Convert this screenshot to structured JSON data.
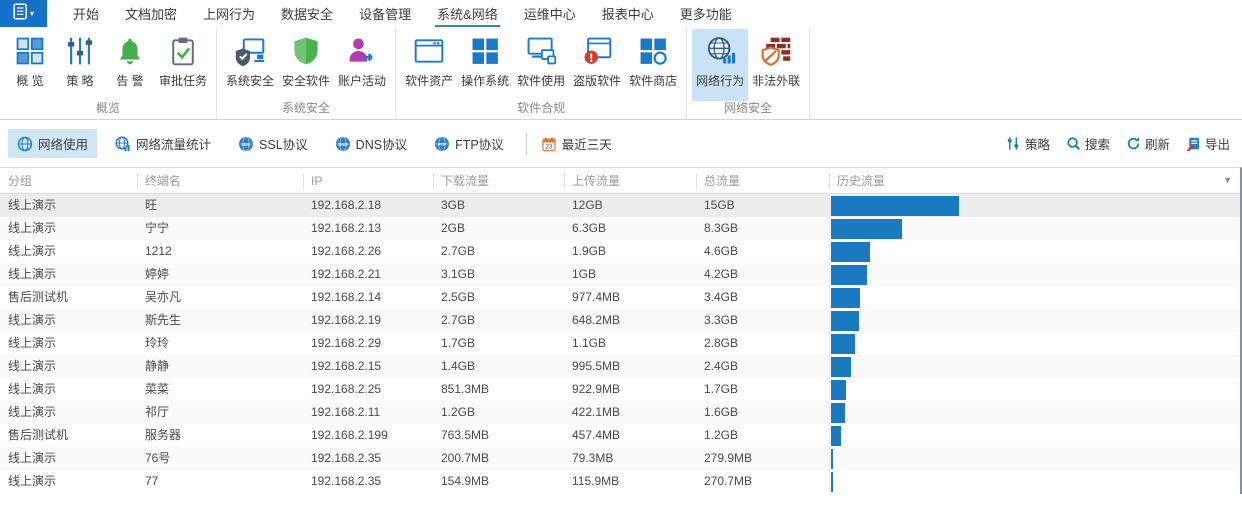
{
  "colors": {
    "app_button_blue": "#1470c8",
    "active_tab_underline": "#3488a8",
    "selected_item_bg": "#c9e2f5",
    "history_bar_color": "#1b79c0",
    "action_icon_teal": "#0e8596"
  },
  "menubar": {
    "tabs": [
      {
        "label": "开始",
        "active": false
      },
      {
        "label": "文档加密",
        "active": false
      },
      {
        "label": "上网行为",
        "active": false
      },
      {
        "label": "数据安全",
        "active": false
      },
      {
        "label": "设备管理",
        "active": false
      },
      {
        "label": "系统&网络",
        "active": true
      },
      {
        "label": "运维中心",
        "active": false
      },
      {
        "label": "报表中心",
        "active": false
      },
      {
        "label": "更多功能",
        "active": false
      }
    ]
  },
  "ribbon": {
    "groups": [
      {
        "label": "概览",
        "items": [
          {
            "label": "概 览",
            "icon": "overview-grid-icon",
            "active": false
          },
          {
            "label": "策 略",
            "icon": "policy-sliders-icon",
            "active": false
          },
          {
            "label": "告 警",
            "icon": "alert-bell-icon",
            "active": false
          },
          {
            "label": "审批任务",
            "icon": "approval-clipboard-icon",
            "active": false
          }
        ]
      },
      {
        "label": "系统安全",
        "items": [
          {
            "label": "系统安全",
            "icon": "system-security-icon",
            "active": false
          },
          {
            "label": "安全软件",
            "icon": "security-software-shield-icon",
            "active": false
          },
          {
            "label": "账户活动",
            "icon": "account-activity-icon",
            "active": false
          }
        ]
      },
      {
        "label": "软件合规",
        "items": [
          {
            "label": "软件资产",
            "icon": "software-asset-window-icon",
            "active": false
          },
          {
            "label": "操作系统",
            "icon": "os-windows-icon",
            "active": false
          },
          {
            "label": "软件使用",
            "icon": "software-usage-icon",
            "active": false
          },
          {
            "label": "盗版软件",
            "icon": "pirated-software-icon",
            "active": false
          },
          {
            "label": "软件商店",
            "icon": "software-store-icon",
            "active": false
          }
        ]
      },
      {
        "label": "网络安全",
        "items": [
          {
            "label": "网络行为",
            "icon": "network-behavior-globe-icon",
            "active": true
          },
          {
            "label": "非法外联",
            "icon": "illegal-connection-shield-icon",
            "active": false
          }
        ]
      }
    ]
  },
  "toolbar": {
    "views": [
      {
        "label": "网络使用",
        "icon": "globe-usage-icon",
        "active": true
      },
      {
        "label": "网络流量统计",
        "icon": "globe-stats-icon",
        "active": false
      },
      {
        "label": "SSL协议",
        "icon": "globe-ssl-icon",
        "active": false
      },
      {
        "label": "DNS协议",
        "icon": "globe-dns-icon",
        "active": false
      },
      {
        "label": "FTP协议",
        "icon": "globe-ftp-icon",
        "active": false
      }
    ],
    "date_range": {
      "label": "最近三天",
      "calendar_day": "23",
      "icon": "calendar-icon"
    },
    "actions": [
      {
        "label": "策略",
        "icon": "policy-sliders-small-icon"
      },
      {
        "label": "搜索",
        "icon": "search-icon"
      },
      {
        "label": "刷新",
        "icon": "refresh-icon"
      },
      {
        "label": "导出",
        "icon": "export-icon"
      }
    ]
  },
  "table": {
    "columns": [
      "分组",
      "终端名",
      "IP",
      "下载流量",
      "上传流量",
      "总流量",
      "历史流量"
    ],
    "history_max_gb": 15,
    "rows": [
      {
        "group": "线上演示",
        "terminal": "旺",
        "ip": "192.168.2.18",
        "download": "3GB",
        "upload": "12GB",
        "total": "15GB",
        "history_gb": 15,
        "selected": true
      },
      {
        "group": "线上演示",
        "terminal": "宁宁",
        "ip": "192.168.2.13",
        "download": "2GB",
        "upload": "6.3GB",
        "total": "8.3GB",
        "history_gb": 8.3,
        "selected": false
      },
      {
        "group": "线上演示",
        "terminal": "1212",
        "ip": "192.168.2.26",
        "download": "2.7GB",
        "upload": "1.9GB",
        "total": "4.6GB",
        "history_gb": 4.6,
        "selected": false
      },
      {
        "group": "线上演示",
        "terminal": "婷婷",
        "ip": "192.168.2.21",
        "download": "3.1GB",
        "upload": "1GB",
        "total": "4.2GB",
        "history_gb": 4.2,
        "selected": false
      },
      {
        "group": "售后测试机",
        "terminal": "吴亦凡",
        "ip": "192.168.2.14",
        "download": "2.5GB",
        "upload": "977.4MB",
        "total": "3.4GB",
        "history_gb": 3.4,
        "selected": false
      },
      {
        "group": "线上演示",
        "terminal": "斯先生",
        "ip": "192.168.2.19",
        "download": "2.7GB",
        "upload": "648.2MB",
        "total": "3.3GB",
        "history_gb": 3.3,
        "selected": false
      },
      {
        "group": "线上演示",
        "terminal": "玲玲",
        "ip": "192.168.2.29",
        "download": "1.7GB",
        "upload": "1.1GB",
        "total": "2.8GB",
        "history_gb": 2.8,
        "selected": false
      },
      {
        "group": "线上演示",
        "terminal": "静静",
        "ip": "192.168.2.15",
        "download": "1.4GB",
        "upload": "995.5MB",
        "total": "2.4GB",
        "history_gb": 2.4,
        "selected": false
      },
      {
        "group": "线上演示",
        "terminal": "菜菜",
        "ip": "192.168.2.25",
        "download": "851.3MB",
        "upload": "922.9MB",
        "total": "1.7GB",
        "history_gb": 1.7,
        "selected": false
      },
      {
        "group": "线上演示",
        "terminal": "祁厅",
        "ip": "192.168.2.11",
        "download": "1.2GB",
        "upload": "422.1MB",
        "total": "1.6GB",
        "history_gb": 1.6,
        "selected": false
      },
      {
        "group": "售后测试机",
        "terminal": "服务器",
        "ip": "192.168.2.199",
        "download": "763.5MB",
        "upload": "457.4MB",
        "total": "1.2GB",
        "history_gb": 1.2,
        "selected": false
      },
      {
        "group": "线上演示",
        "terminal": "76号",
        "ip": "192.168.2.35",
        "download": "200.7MB",
        "upload": "79.3MB",
        "total": "279.9MB",
        "history_gb": 0.27,
        "selected": false
      },
      {
        "group": "线上演示",
        "terminal": "77",
        "ip": "192.168.2.35",
        "download": "154.9MB",
        "upload": "115.9MB",
        "total": "270.7MB",
        "history_gb": 0.26,
        "selected": false
      }
    ]
  }
}
